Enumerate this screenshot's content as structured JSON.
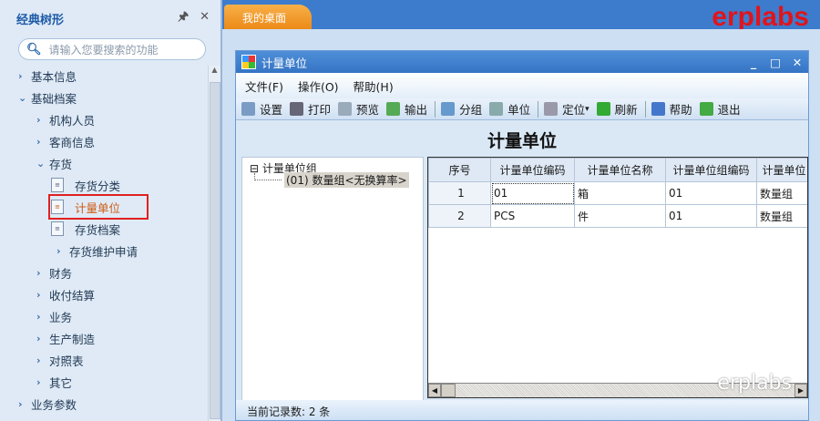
{
  "sidebar": {
    "title": "经典树形",
    "pin_icon": "pin-icon",
    "close_icon": "close-icon",
    "search_placeholder": "请输入您要搜索的功能",
    "items": [
      {
        "label": "基本信息",
        "state": "collapsed"
      },
      {
        "label": "基础档案",
        "state": "expanded"
      },
      {
        "label": "机构人员",
        "state": "collapsed"
      },
      {
        "label": "客商信息",
        "state": "collapsed"
      },
      {
        "label": "存货",
        "state": "expanded"
      },
      {
        "label": "存货分类",
        "state": "leaf"
      },
      {
        "label": "计量单位",
        "state": "selected"
      },
      {
        "label": "存货档案",
        "state": "leaf"
      },
      {
        "label": "存货维护申请",
        "state": "collapsed"
      },
      {
        "label": "财务",
        "state": "collapsed"
      },
      {
        "label": "收付结算",
        "state": "collapsed"
      },
      {
        "label": "业务",
        "state": "collapsed"
      },
      {
        "label": "生产制造",
        "state": "collapsed"
      },
      {
        "label": "对照表",
        "state": "collapsed"
      },
      {
        "label": "其它",
        "state": "collapsed"
      },
      {
        "label": "业务参数",
        "state": "collapsed"
      }
    ]
  },
  "tabs": [
    {
      "label": "我的桌面"
    }
  ],
  "brand": "erplabs",
  "window": {
    "title": "计量单位",
    "menu": [
      "文件(F)",
      "操作(O)",
      "帮助(H)"
    ],
    "toolbar": [
      "设置",
      "打印",
      "预览",
      "输出",
      "分组",
      "单位",
      "定位",
      "刷新",
      "帮助",
      "退出"
    ],
    "heading": "计量单位",
    "tree": {
      "root": "计量单位组",
      "child": "(01) 数量组<无换算率>"
    },
    "grid": {
      "columns": [
        "序号",
        "计量单位编码",
        "计量单位名称",
        "计量单位组编码",
        "计量单位"
      ],
      "rows": [
        [
          "1",
          "01",
          "箱",
          "01",
          "数量组"
        ],
        [
          "2",
          "PCS",
          "件",
          "01",
          "数量组"
        ]
      ]
    },
    "status": "当前记录数: 2 条"
  },
  "watermark": "erplabs"
}
